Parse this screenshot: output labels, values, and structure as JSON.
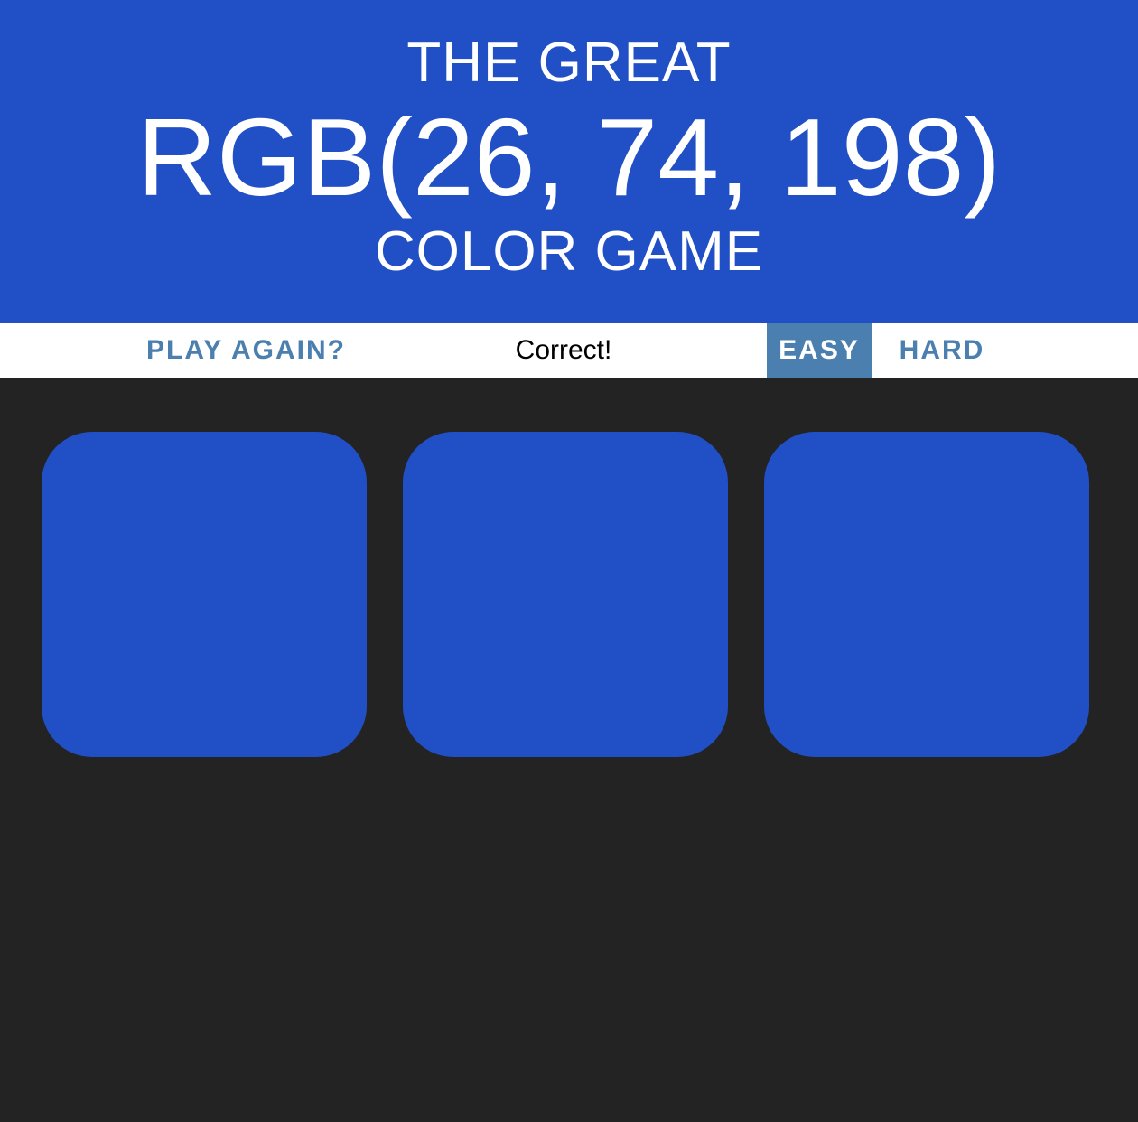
{
  "header": {
    "title_top": "THE GREAT",
    "color_display": "RGB(26, 74, 198)",
    "title_bottom": "COLOR GAME",
    "background_color": "#214fc5"
  },
  "stripe": {
    "reset_label": "PLAY AGAIN?",
    "message": "Correct!",
    "modes": [
      {
        "label": "EASY",
        "selected": true
      },
      {
        "label": "HARD",
        "selected": false
      }
    ],
    "accent_color": "#4b7fb0"
  },
  "squares": [
    {
      "color": "#214fc5"
    },
    {
      "color": "#214fc5"
    },
    {
      "color": "#214fc5"
    }
  ],
  "background_color": "#232323"
}
